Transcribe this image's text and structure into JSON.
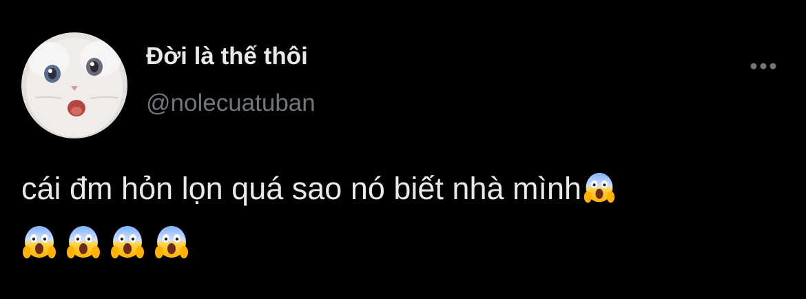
{
  "tweet": {
    "display_name": "Đời là thế thôi",
    "handle": "@nolecuatuban",
    "text": "cái đm hỏn lọn quá sao nó biết nhà mình",
    "emojis": [
      "😱",
      "😱",
      "😱",
      "😱",
      "😱"
    ],
    "avatar_icon": "white-kitten-avatar",
    "more_icon": "more-horizontal-icon"
  },
  "colors": {
    "background": "#000000",
    "primary_text": "#e7e9ea",
    "secondary_text": "#71767b"
  }
}
